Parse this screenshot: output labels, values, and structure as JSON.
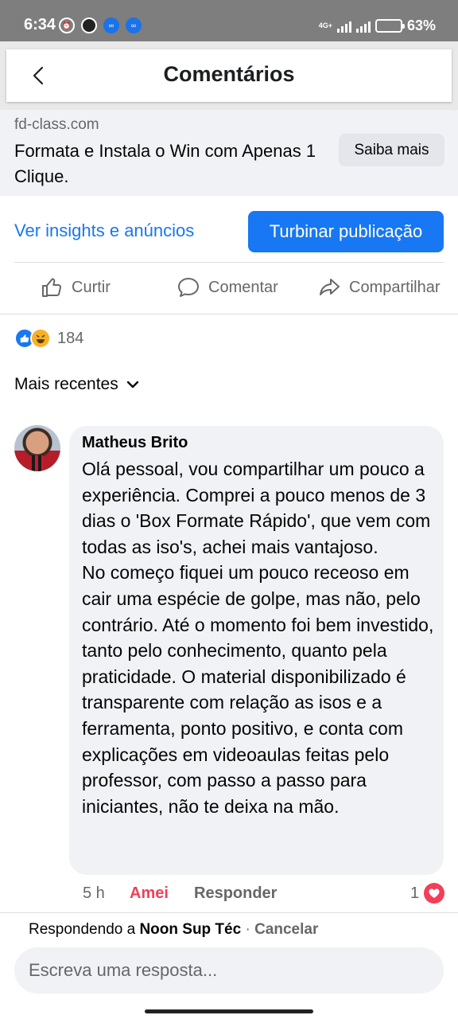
{
  "status_bar": {
    "time": "6:34",
    "network": "4G+",
    "battery": "63%",
    "battery_level": 0.63
  },
  "header": {
    "title": "Comentários",
    "back_icon": "chevron-left-icon"
  },
  "ad_preview": {
    "domain": "fd-class.com",
    "title": "Formata e Instala o Win com Apenas 1 Clique.",
    "cta": "Saiba mais"
  },
  "actions": {
    "insights": "Ver insights e anúncios",
    "boost": "Turbinar publicação"
  },
  "reaction_buttons": [
    {
      "label": "Curtir",
      "icon": "like-icon"
    },
    {
      "label": "Comentar",
      "icon": "comment-icon"
    },
    {
      "label": "Compartilhar",
      "icon": "share-icon"
    }
  ],
  "reactions_summary": {
    "count": "184",
    "types": [
      "like",
      "haha"
    ]
  },
  "sort": {
    "label": "Mais recentes"
  },
  "comment": {
    "author": "Matheus Brito",
    "text": "Olá pessoal, vou compartilhar um pouco a experiência. Comprei a pouco menos de 3 dias o 'Box Formate Rápido', que vem com todas as iso's, achei mais vantajoso.\nNo começo fiquei um pouco receoso em cair uma espécie de golpe, mas não, pelo contrário. Até o momento foi bem investido, tanto pelo conhecimento, quanto pela praticidade. O material disponibilizado é transparente com relação as isos e a ferramenta, ponto positivo, e conta com explicações em videoaulas feitas pelo professor, com passo a passo para iniciantes, não te deixa na mão.",
    "time": "5 h",
    "reaction_label": "Amei",
    "reply_label": "Responder",
    "reaction_count": "1"
  },
  "composer": {
    "replying_prefix": "Respondendo a",
    "replying_to": "Noon Sup Téc",
    "separator": "·",
    "cancel": "Cancelar",
    "placeholder": "Escreva uma resposta..."
  },
  "colors": {
    "accent": "#1877f2",
    "love": "#f33e58",
    "bubble": "#f0f2f5",
    "secondary_text": "#65676b"
  }
}
